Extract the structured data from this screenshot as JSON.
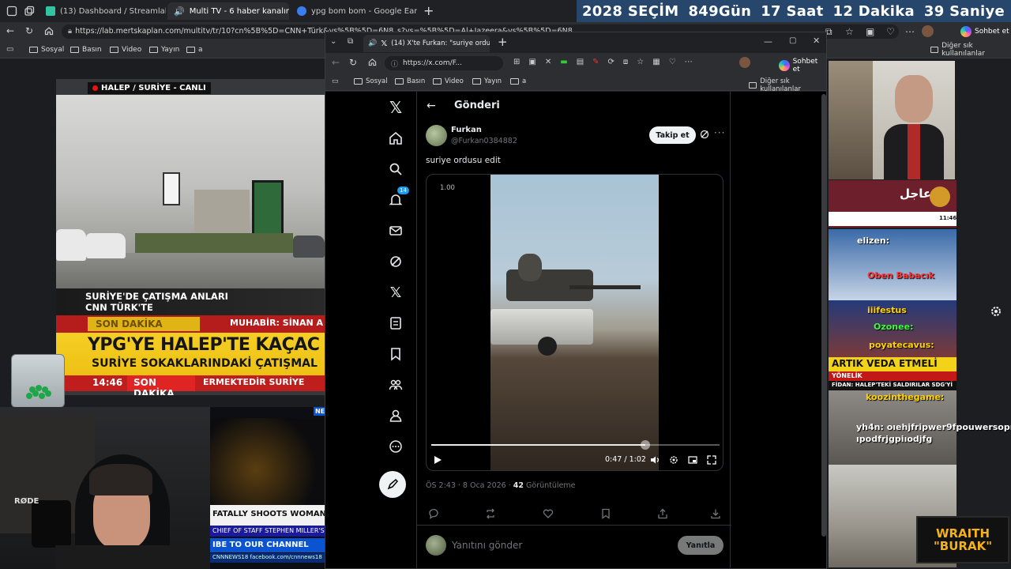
{
  "outer_browser": {
    "tabs": [
      {
        "label": "(13) Dashboard / Streamlabs"
      },
      {
        "label": "Multi TV - 6 haber kanalını ay"
      },
      {
        "label": "ypg bom bom - Google Earth"
      }
    ],
    "url": "https://lab.mertskaplan.com/multitv/tr/10?cn%5B%5D=CNN+Türk&vs%5B%5D=6N8_s?vs=%5B%5D=Al+Jazeera&vs%5B%5D=6N8...",
    "bookmarks": [
      "Sosyal",
      "Basın",
      "Video",
      "Yayın",
      "a"
    ],
    "other_bookmarks": "Diğer sık kullanılanlar",
    "chat_label": "Sohbet et"
  },
  "countdown": {
    "year": "2028",
    "event": "SEÇİM",
    "days": "849",
    "days_unit": "Gün",
    "hours": "17",
    "hours_unit": "Saat",
    "minutes": "12",
    "minutes_unit": "Dakika",
    "seconds": "39",
    "seconds_unit": "Saniye"
  },
  "cnn_feed": {
    "location_tag": "HALEP / SURİYE - CANLI",
    "lower_line1": "SURİYE'DE ÇATIŞMA ANLARI",
    "lower_line2": "CNN TÜRK'TE",
    "son_dakika_logo": "SON DAKİKA",
    "reporter": "MUHABİR: SİNAN A",
    "headline": "YPG'YE HALEP'TE KAÇAC",
    "subheadline": "SURİYE SOKAKLARINDAKİ ÇATIŞMAL",
    "time": "14:46",
    "son_dakika": "SON DAKİKA",
    "ticker": "ERMEKTEDİR    SURİYE"
  },
  "webcam": {
    "mic_brand": "RØDE"
  },
  "news18": {
    "headline": "FATALLY SHOOTS WOMAN",
    "subline": "CHIEF OF STAFF STEPHEN MILLER'S",
    "subscribe": "IBE TO OUR CHANNEL",
    "facebook": "CNNNEWS18  facebook.com/cnnnews18",
    "badge": "NE"
  },
  "inner_browser": {
    "tab_label": "(14) X'te Furkan: \"suriye ordus",
    "url": "https://x.com/F...",
    "bookmarks": [
      "Sosyal",
      "Basın",
      "Video",
      "Yayın",
      "a"
    ],
    "other_bookmarks": "Diğer sık kullanılanlar",
    "chat_label": "Sohbet et"
  },
  "x": {
    "notifications_badge": "14",
    "page_title": "Gönderi",
    "author_name": "Furkan",
    "author_handle": "@Furkan0384882",
    "follow_label": "Takip et",
    "tweet_text": "suriye ordusu edit",
    "video": {
      "speed": "1.00",
      "current_time": "0:47",
      "duration": "1:02",
      "progress": 0.742
    },
    "timestamp": "ÖS 2:43 · 8 Oca 2026 · ",
    "views_count": "42",
    "views_label": " Görüntüleme",
    "reply_placeholder": "Yanıtını gönder",
    "reply_button": "Yanıtla"
  },
  "right_column": {
    "aljazeera_breaking": "عاجل",
    "aljazeera_time": "11:46",
    "chat": [
      {
        "user": "elizen:",
        "color": "#ffffff"
      },
      {
        "user": "Oben Babacık",
        "color": "#ff3a3a"
      },
      {
        "user": "iiifestus",
        "color": "#ffd400"
      },
      {
        "user": "Ozonee:",
        "color": "#3aff3a"
      },
      {
        "user": "poyatecavus:",
        "color": "#ffd400"
      },
      {
        "user": "koozinthegame:",
        "color": "#ffd400"
      },
      {
        "user": "yh4n: oıehjfripwer9fpouwersopıgjf",
        "color": "#ffffff"
      },
      {
        "user": "ıpodfrjgpiıodjfg",
        "color": "#ffffff"
      }
    ],
    "banner1": "ARTIK VEDA ETMELİ",
    "banner2": "FİDAN: HALEP'TEKİ SALDIRILAR SDG'Yİ",
    "banner3": "YÖNELİK",
    "wraith_line1": "WRAITH",
    "wraith_line2": "\"BURAK\""
  }
}
